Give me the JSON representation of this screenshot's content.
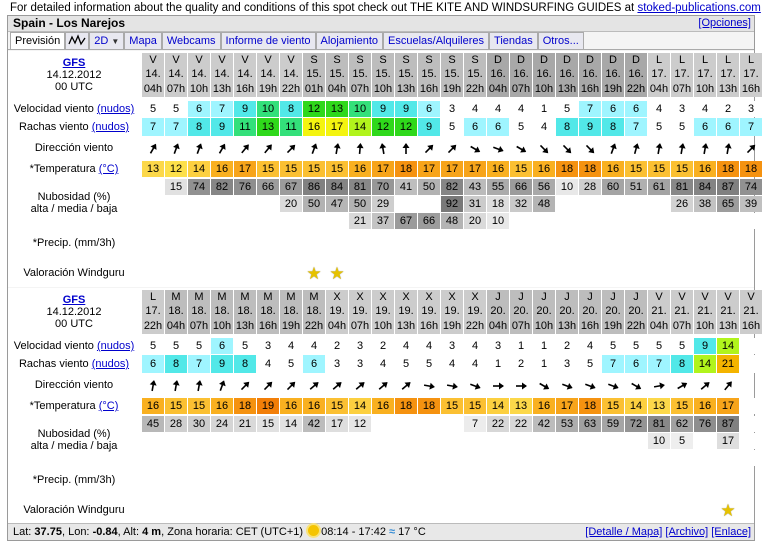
{
  "info": {
    "text": "For detailed information about the quality and conditions of this spot check out THE KITE AND WINDSURFING GUIDES at ",
    "link": "stoked-publications.com"
  },
  "title": "Spain - Los Narejos",
  "opciones": "[Opciones]",
  "tabs": {
    "prevision": "Previsión",
    "twod": "2D",
    "mapa": "Mapa",
    "webcams": "Webcams",
    "informe": "Informe de viento",
    "alojamiento": "Alojamiento",
    "escuelas": "Escuelas/Alquileres",
    "tiendas": "Tiendas",
    "otros": "Otros..."
  },
  "labels": {
    "model": "GFS",
    "run_date": "14.12.2012",
    "run_time": "00 UTC",
    "speed": "Velocidad viento",
    "gusts": "Rachas viento",
    "knots": "(nudos)",
    "dir": "Dirección viento",
    "temp": "*Temperatura",
    "celsius": "(°C)",
    "cloud1": "Nubosidad (%)",
    "cloud2": "alta / media / baja",
    "precip": "*Precip. (mm/3h)",
    "rating": "Valoración Windguru"
  },
  "footer": {
    "lat_label": "Lat:",
    "lat": "37.75",
    "lon_label": "Lon:",
    "lon": "-0.84",
    "alt_label": "Alt:",
    "alt": "4 m",
    "tz": "Zona horaria: CET (UTC+1)",
    "sun": "08:14 - 17:42",
    "sea": "17 °C",
    "detalle": "[Detalle / Mapa]",
    "archivo": "[Archivo]",
    "enlace": "[Enlace]"
  },
  "colors": {
    "c1": "#ffffff",
    "c2": "#9ff5ff",
    "c3": "#52e8e8",
    "c4": "#33e07a",
    "c5": "#2fd81b",
    "c6": "#b1f41c",
    "c7": "#f4f40f"
  },
  "blocks": [
    {
      "days": [
        "V",
        "V",
        "V",
        "V",
        "V",
        "V",
        "V",
        "S",
        "S",
        "S",
        "S",
        "S",
        "S",
        "S",
        "S",
        "D",
        "D",
        "D",
        "D",
        "D",
        "D",
        "D",
        "L",
        "L",
        "L",
        "L",
        "L"
      ],
      "dates": [
        "14.",
        "14.",
        "14.",
        "14.",
        "14.",
        "14.",
        "14.",
        "15.",
        "15.",
        "15.",
        "15.",
        "15.",
        "15.",
        "15.",
        "15.",
        "16.",
        "16.",
        "16.",
        "16.",
        "16.",
        "16.",
        "16.",
        "17.",
        "17.",
        "17.",
        "17.",
        "17."
      ],
      "hours": [
        "04h",
        "07h",
        "10h",
        "13h",
        "16h",
        "19h",
        "22h",
        "01h",
        "04h",
        "07h",
        "10h",
        "13h",
        "16h",
        "19h",
        "22h",
        "04h",
        "07h",
        "10h",
        "13h",
        "16h",
        "19h",
        "22h",
        "04h",
        "07h",
        "10h",
        "13h",
        "16h"
      ],
      "speed": [
        "5",
        "5",
        "6",
        "7",
        "9",
        "10",
        "8",
        "12",
        "13",
        "10",
        "9",
        "9",
        "6",
        "3",
        "4",
        "4",
        "4",
        "1",
        "5",
        "7",
        "6",
        "6",
        "4",
        "3",
        "4",
        "2",
        "3"
      ],
      "gusts": [
        "7",
        "7",
        "8",
        "9",
        "11",
        "13",
        "11",
        "16",
        "17",
        "14",
        "12",
        "12",
        "9",
        "5",
        "6",
        "6",
        "5",
        "4",
        "8",
        "9",
        "8",
        "7",
        "5",
        "5",
        "6",
        "6",
        "7"
      ],
      "dirs": [
        60,
        70,
        70,
        60,
        50,
        50,
        45,
        70,
        80,
        85,
        100,
        90,
        45,
        45,
        -30,
        -20,
        -30,
        -45,
        -45,
        -45,
        70,
        75,
        80,
        80,
        80,
        80,
        45
      ],
      "temp": [
        "13",
        "12",
        "14",
        "16",
        "17",
        "15",
        "15",
        "15",
        "15",
        "16",
        "17",
        "18",
        "17",
        "17",
        "17",
        "16",
        "15",
        "16",
        "18",
        "18",
        "16",
        "15",
        "15",
        "15",
        "16",
        "18",
        "18"
      ],
      "cl_high": [
        "",
        "15",
        "74",
        "82",
        "76",
        "66",
        "67",
        "86",
        "84",
        "81",
        "70",
        "41",
        "50",
        "82",
        "43",
        "55",
        "66",
        "56",
        "10",
        "28",
        "60",
        "51",
        "61",
        "81",
        "84",
        "87",
        "74"
      ],
      "cl_mid": [
        "",
        "",
        "",
        "",
        "",
        "",
        "20",
        "50",
        "47",
        "50",
        "29",
        "",
        "",
        "92",
        "31",
        "18",
        "32",
        "48",
        "",
        "",
        "",
        "",
        "",
        "26",
        "38",
        "65",
        "39"
      ],
      "cl_low": [
        "",
        "",
        "",
        "",
        "",
        "",
        "",
        "",
        "",
        "21",
        "37",
        "67",
        "66",
        "48",
        "20",
        "10",
        "",
        "",
        "",
        "",
        "",
        "",
        "",
        "",
        "",
        "",
        ""
      ],
      "precip": [
        "",
        "",
        "",
        "",
        "",
        "",
        "",
        "",
        "",
        "",
        "",
        "",
        "",
        "",
        "",
        "",
        "",
        "",
        "",
        "",
        "",
        "",
        "",
        "",
        "",
        "",
        ""
      ],
      "stars": [
        "",
        "",
        "",
        "",
        "",
        "",
        "",
        "1",
        "1",
        "",
        "",
        "",
        "",
        "",
        "",
        "",
        "",
        "",
        "",
        "",
        "",
        "",
        "",
        "",
        "",
        "",
        ""
      ]
    },
    {
      "days": [
        "L",
        "M",
        "M",
        "M",
        "M",
        "M",
        "M",
        "M",
        "X",
        "X",
        "X",
        "X",
        "X",
        "X",
        "X",
        "J",
        "J",
        "J",
        "J",
        "J",
        "J",
        "J",
        "V",
        "V",
        "V",
        "V",
        "V"
      ],
      "dates": [
        "17.",
        "18.",
        "18.",
        "18.",
        "18.",
        "18.",
        "18.",
        "18.",
        "19.",
        "19.",
        "19.",
        "19.",
        "19.",
        "19.",
        "19.",
        "20.",
        "20.",
        "20.",
        "20.",
        "20.",
        "20.",
        "20.",
        "21.",
        "21.",
        "21.",
        "21.",
        "21."
      ],
      "hours": [
        "22h",
        "04h",
        "07h",
        "10h",
        "13h",
        "16h",
        "19h",
        "22h",
        "04h",
        "07h",
        "10h",
        "13h",
        "16h",
        "19h",
        "22h",
        "04h",
        "07h",
        "10h",
        "13h",
        "16h",
        "19h",
        "22h",
        "04h",
        "07h",
        "10h",
        "13h",
        "16h"
      ],
      "speed": [
        "5",
        "5",
        "5",
        "6",
        "5",
        "3",
        "4",
        "4",
        "2",
        "3",
        "2",
        "4",
        "4",
        "3",
        "4",
        "3",
        "1",
        "1",
        "2",
        "4",
        "5",
        "5",
        "5",
        "5",
        "9",
        "14",
        ""
      ],
      "gusts": [
        "6",
        "8",
        "7",
        "9",
        "8",
        "4",
        "5",
        "6",
        "3",
        "3",
        "4",
        "5",
        "5",
        "4",
        "4",
        "1",
        "2",
        "1",
        "3",
        "5",
        "7",
        "6",
        "7",
        "8",
        "14",
        "21",
        ""
      ],
      "dirs": [
        80,
        80,
        80,
        70,
        45,
        45,
        45,
        40,
        40,
        40,
        40,
        40,
        -10,
        -10,
        -20,
        0,
        0,
        -30,
        -20,
        -20,
        -20,
        -30,
        10,
        30,
        40,
        50,
        0
      ],
      "temp": [
        "16",
        "15",
        "15",
        "16",
        "18",
        "19",
        "16",
        "16",
        "15",
        "14",
        "16",
        "18",
        "18",
        "15",
        "15",
        "14",
        "13",
        "16",
        "17",
        "18",
        "15",
        "14",
        "13",
        "15",
        "16",
        "17",
        ""
      ],
      "cl_high": [
        "45",
        "28",
        "30",
        "24",
        "21",
        "15",
        "14",
        "42",
        "17",
        "12",
        "",
        "",
        "",
        "",
        "7",
        "22",
        "22",
        "42",
        "53",
        "63",
        "59",
        "72",
        "81",
        "62",
        "76",
        "87",
        ""
      ],
      "cl_mid": [
        "",
        "",
        "",
        "",
        "",
        "",
        "",
        "",
        "",
        "",
        "",
        "",
        "",
        "",
        "",
        "",
        "",
        "",
        "",
        "",
        "",
        "",
        "10",
        "5",
        "",
        "17",
        ""
      ],
      "cl_low": [
        "",
        "",
        "",
        "",
        "",
        "",
        "",
        "",
        "",
        "",
        "",
        "",
        "",
        "",
        "",
        "",
        "",
        "",
        "",
        "",
        "",
        "",
        "",
        "",
        "",
        "",
        ""
      ],
      "precip": [
        "",
        "",
        "",
        "",
        "",
        "",
        "",
        "",
        "",
        "",
        "",
        "",
        "",
        "",
        "",
        "",
        "",
        "",
        "",
        "",
        "",
        "",
        "",
        "",
        "",
        "",
        ""
      ],
      "stars": [
        "",
        "",
        "",
        "",
        "",
        "",
        "",
        "",
        "",
        "",
        "",
        "",
        "",
        "",
        "",
        "",
        "",
        "",
        "",
        "",
        "",
        "",
        "",
        "",
        "",
        "1",
        ""
      ]
    }
  ]
}
